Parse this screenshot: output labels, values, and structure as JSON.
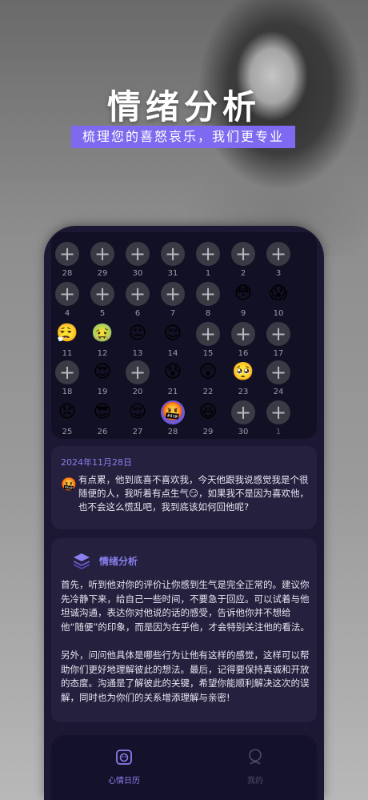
{
  "hero": {
    "title": "情绪分析",
    "subtitle": "梳理您的喜怒哀乐，我们更专业"
  },
  "calendar": {
    "days": [
      {
        "num": "28",
        "emoji": null,
        "dim": false
      },
      {
        "num": "29",
        "emoji": null,
        "dim": false
      },
      {
        "num": "30",
        "emoji": null,
        "dim": false
      },
      {
        "num": "31",
        "emoji": null,
        "dim": false
      },
      {
        "num": "1",
        "emoji": null,
        "dim": false
      },
      {
        "num": "2",
        "emoji": null,
        "dim": false
      },
      {
        "num": "3",
        "emoji": null,
        "dim": false
      },
      {
        "num": "4",
        "emoji": null,
        "dim": false
      },
      {
        "num": "5",
        "emoji": null,
        "dim": false
      },
      {
        "num": "6",
        "emoji": null,
        "dim": false
      },
      {
        "num": "7",
        "emoji": null,
        "dim": false
      },
      {
        "num": "8",
        "emoji": null,
        "dim": false
      },
      {
        "num": "9",
        "emoji": "😳",
        "dim": false
      },
      {
        "num": "10",
        "emoji": "😱",
        "dim": false
      },
      {
        "num": "11",
        "emoji": "😮‍💨",
        "dim": false
      },
      {
        "num": "12",
        "emoji": "🤢",
        "dim": false
      },
      {
        "num": "13",
        "emoji": "😐",
        "dim": false
      },
      {
        "num": "14",
        "emoji": "😌",
        "dim": false
      },
      {
        "num": "15",
        "emoji": null,
        "dim": false
      },
      {
        "num": "16",
        "emoji": null,
        "dim": false
      },
      {
        "num": "17",
        "emoji": null,
        "dim": false
      },
      {
        "num": "18",
        "emoji": null,
        "dim": false
      },
      {
        "num": "19",
        "emoji": "😍",
        "dim": false
      },
      {
        "num": "20",
        "emoji": null,
        "dim": false
      },
      {
        "num": "21",
        "emoji": "😰",
        "dim": false
      },
      {
        "num": "22",
        "emoji": "😲",
        "dim": false
      },
      {
        "num": "23",
        "emoji": "🥺",
        "dim": false
      },
      {
        "num": "24",
        "emoji": null,
        "dim": false
      },
      {
        "num": "25",
        "emoji": "😞",
        "dim": false
      },
      {
        "num": "26",
        "emoji": "😎",
        "dim": false
      },
      {
        "num": "27",
        "emoji": "😌",
        "dim": false
      },
      {
        "num": "28",
        "emoji": "🤬",
        "dim": false,
        "selected": true
      },
      {
        "num": "29",
        "emoji": "😆",
        "dim": false
      },
      {
        "num": "30",
        "emoji": null,
        "dim": false
      },
      {
        "num": "1",
        "emoji": null,
        "dim": true
      }
    ],
    "add_symbol": "+"
  },
  "entry": {
    "date": "2024年11月28日",
    "emoji": "🤬",
    "text": "有点累，他到底喜不喜欢我，今天他跟我说感觉我是个很随便的人，我听着有点生气😏，如果我不是因为喜欢他，也不会这么慌乱吧，我到底该如何回他呢?"
  },
  "analysis": {
    "title": "情绪分析",
    "paragraph1": "首先，听到他对你的评价让你感到生气是完全正常的。建议你先冷静下来，给自己一些时间，不要急于回应。可以试着与他坦诚沟通，表达你对他说的话的感受，告诉他你并不想给他“随便”的印象，而是因为在乎他，才会特别关注他的看法。",
    "paragraph2": "另外，问问他具体是哪些行为让他有这样的感觉，这样可以帮助你们更好地理解彼此的想法。最后，记得要保持真诚和开放的态度。沟通是了解彼此的关键，希望你能顺利解决这次的误解，同时也为你们的关系增添理解与亲密!"
  },
  "tabs": [
    {
      "label": "心情日历",
      "active": true,
      "icon": "mood-calendar-icon"
    },
    {
      "label": "我的",
      "active": false,
      "icon": "profile-icon"
    }
  ],
  "colors": {
    "accent": "#8b7ff0",
    "subtitle_bg": "#7e6af0",
    "panel_bg": "#1c1733",
    "calendar_bg": "#121024",
    "card_bg": "#24203d",
    "add_circle": "#3a3a44"
  }
}
